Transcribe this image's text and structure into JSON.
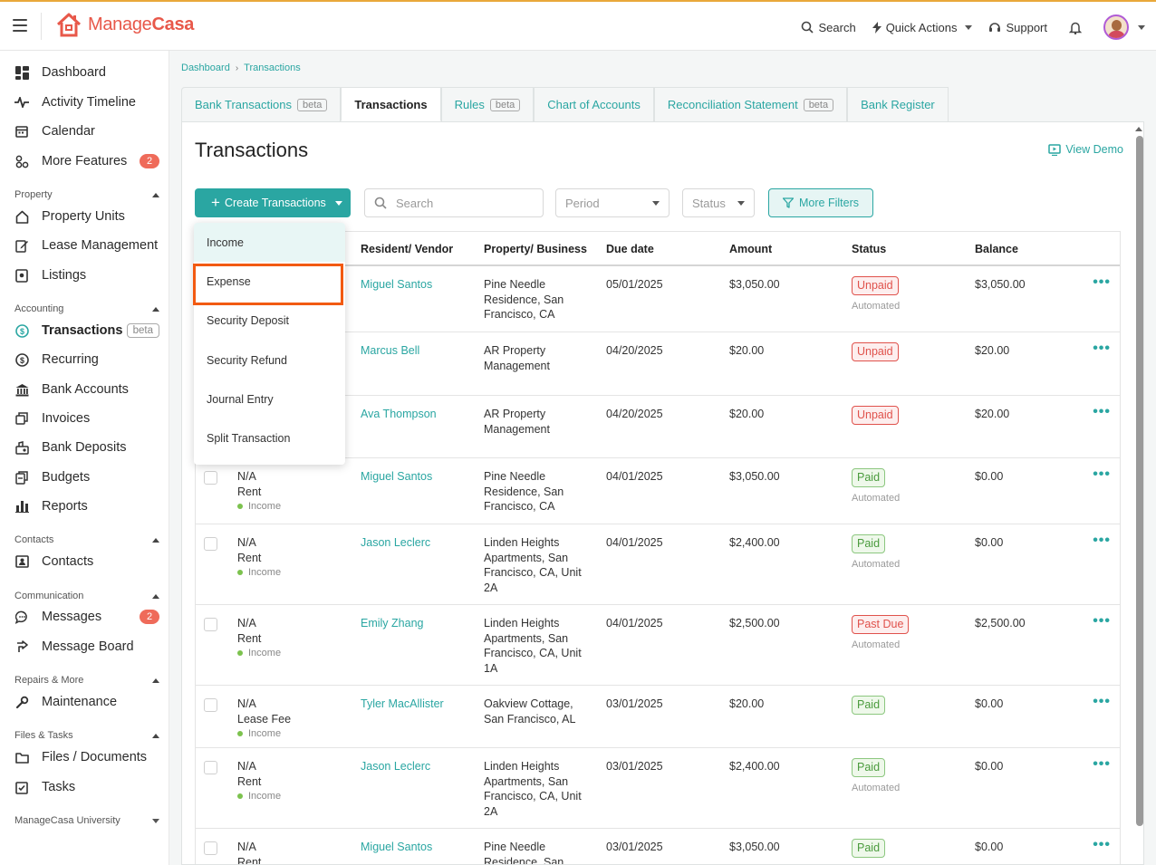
{
  "app": {
    "logo_text_light": "Manage",
    "logo_text_bold": "Casa",
    "brand_color": "#e8584a",
    "accent_color": "#2aa6a2"
  },
  "topbar": {
    "search_label": "Search",
    "quick_actions_label": "Quick Actions",
    "support_label": "Support"
  },
  "sidebar": {
    "top_items": [
      {
        "label": "Dashboard",
        "icon": "dashboard-icon"
      },
      {
        "label": "Activity Timeline",
        "icon": "activity-icon"
      },
      {
        "label": "Calendar",
        "icon": "calendar-icon"
      },
      {
        "label": "More Features",
        "icon": "features-icon",
        "badge": "2"
      }
    ],
    "sections": {
      "property": {
        "label": "Property",
        "items": [
          "Property Units",
          "Lease Management",
          "Listings"
        ]
      },
      "accounting": {
        "label": "Accounting",
        "items": [
          "Transactions",
          "Recurring",
          "Bank Accounts",
          "Invoices",
          "Bank Deposits",
          "Budgets",
          "Reports"
        ],
        "transactions_beta": "beta"
      },
      "contacts": {
        "label": "Contacts",
        "items": [
          "Contacts"
        ]
      },
      "communication": {
        "label": "Communication",
        "items": [
          "Messages",
          "Message Board"
        ],
        "messages_badge": "2"
      },
      "repairs": {
        "label": "Repairs & More",
        "items": [
          "Maintenance"
        ]
      },
      "files": {
        "label": "Files & Tasks",
        "items": [
          "Files / Documents",
          "Tasks"
        ]
      },
      "university": {
        "label": "ManageCasa University"
      }
    }
  },
  "breadcrumb": [
    "Dashboard",
    "Transactions"
  ],
  "tabs": [
    {
      "label": "Bank Transactions",
      "beta": "beta"
    },
    {
      "label": "Transactions",
      "active": true
    },
    {
      "label": "Rules",
      "beta": "beta"
    },
    {
      "label": "Chart of Accounts"
    },
    {
      "label": "Reconciliation Statement",
      "beta": "beta"
    },
    {
      "label": "Bank Register"
    }
  ],
  "page": {
    "title": "Transactions",
    "view_demo": "View Demo"
  },
  "toolbar": {
    "create_label": "Create Transactions",
    "search_placeholder": "Search",
    "period_placeholder": "Period",
    "status_placeholder": "Status",
    "more_filters_label": "More Filters"
  },
  "create_menu": {
    "items": [
      "Income",
      "Expense",
      "Security Deposit",
      "Security Refund",
      "Journal Entry",
      "Split Transaction"
    ],
    "highlighted": "Expense"
  },
  "table": {
    "headers": [
      "Resident/ Vendor",
      "Property/ Business",
      "Due date",
      "Amount",
      "Status",
      "Balance"
    ],
    "rows": [
      {
        "name": "Miguel Santos",
        "property": [
          "Pine Needle",
          "Residence, San",
          "Francisco, CA"
        ],
        "due": "05/01/2025",
        "amount": "$3,050.00",
        "status": "Unpaid",
        "status_type": "unpaid",
        "automated": "Automated",
        "balance": "$3,050.00"
      },
      {
        "name": "Marcus Bell",
        "property": [
          "AR Property",
          "Management"
        ],
        "due": "04/20/2025",
        "amount": "$20.00",
        "status": "Unpaid",
        "status_type": "unpaid",
        "balance": "$20.00"
      },
      {
        "name": "Ava Thompson",
        "property": [
          "AR Property",
          "Management"
        ],
        "due": "04/20/2025",
        "amount": "$20.00",
        "status": "Unpaid",
        "status_type": "unpaid",
        "balance": "$20.00"
      },
      {
        "ref": "N/A",
        "type": "Rent",
        "category": "Income",
        "name": "Miguel Santos",
        "property": [
          "Pine Needle",
          "Residence, San",
          "Francisco, CA"
        ],
        "due": "04/01/2025",
        "amount": "$3,050.00",
        "status": "Paid",
        "status_type": "paid",
        "automated": "Automated",
        "balance": "$0.00"
      },
      {
        "ref": "N/A",
        "type": "Rent",
        "category": "Income",
        "name": "Jason Leclerc",
        "property": [
          "Linden Heights",
          "Apartments, San",
          "Francisco, CA, Unit",
          "2A"
        ],
        "due": "04/01/2025",
        "amount": "$2,400.00",
        "status": "Paid",
        "status_type": "paid",
        "automated": "Automated",
        "balance": "$0.00"
      },
      {
        "ref": "N/A",
        "type": "Rent",
        "category": "Income",
        "name": "Emily Zhang",
        "property": [
          "Linden Heights",
          "Apartments, San",
          "Francisco, CA, Unit",
          "1A"
        ],
        "due": "04/01/2025",
        "amount": "$2,500.00",
        "status": "Past Due",
        "status_type": "pastdue",
        "automated": "Automated",
        "balance": "$2,500.00"
      },
      {
        "ref": "N/A",
        "type": "Lease Fee",
        "category": "Income",
        "name": "Tyler MacAllister",
        "property": [
          "Oakview Cottage,",
          "San Francisco, AL"
        ],
        "due": "03/01/2025",
        "amount": "$20.00",
        "status": "Paid",
        "status_type": "paid",
        "balance": "$0.00"
      },
      {
        "ref": "N/A",
        "type": "Rent",
        "category": "Income",
        "name": "Jason Leclerc",
        "property": [
          "Linden Heights",
          "Apartments, San",
          "Francisco, CA, Unit",
          "2A"
        ],
        "due": "03/01/2025",
        "amount": "$2,400.00",
        "status": "Paid",
        "status_type": "paid",
        "automated": "Automated",
        "balance": "$0.00"
      },
      {
        "ref": "N/A",
        "type": "Rent",
        "name": "Miguel Santos",
        "property": [
          "Pine Needle",
          "Residence, San"
        ],
        "due": "03/01/2025",
        "amount": "$3,050.00",
        "status": "Paid",
        "status_type": "paid",
        "balance": "$0.00"
      }
    ]
  }
}
